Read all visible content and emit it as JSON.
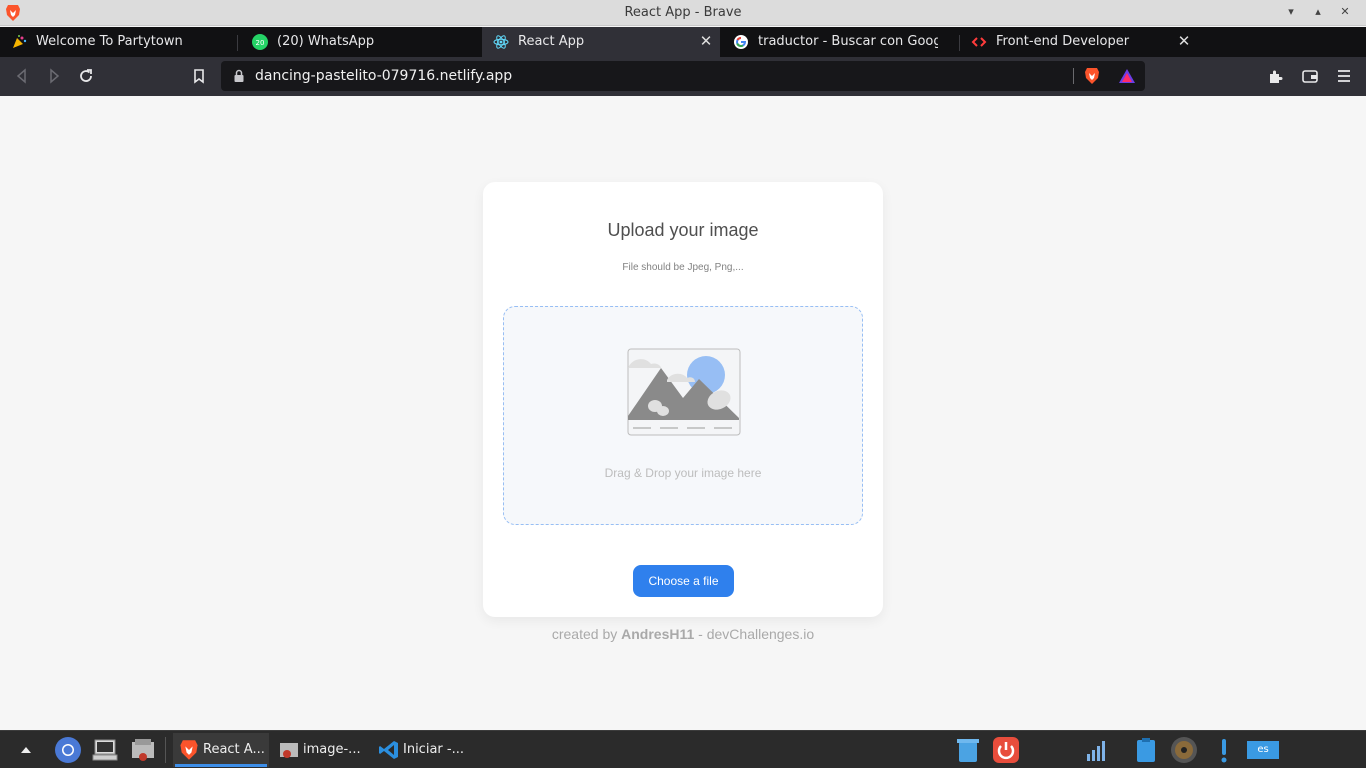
{
  "window": {
    "title": "React App - Brave"
  },
  "tabs": [
    {
      "label": "Welcome To Partytown",
      "icon": "partytown-icon"
    },
    {
      "label": "(20) WhatsApp",
      "icon": "whatsapp-icon",
      "badge": "20"
    },
    {
      "label": "React App",
      "icon": "react-icon",
      "active": true
    },
    {
      "label": "traductor - Buscar con Google",
      "icon": "google-icon"
    },
    {
      "label": "Front-end Developer",
      "icon": "code-icon"
    }
  ],
  "toolbar": {
    "url": "dancing-pastelito-079716.netlify.app"
  },
  "card": {
    "title": "Upload your image",
    "subtitle": "File should be Jpeg, Png,...",
    "dropzone_text": "Drag & Drop your image here",
    "button_label": "Choose a file"
  },
  "footer": {
    "prefix": "created by",
    "author": "AndresH11",
    "suffix": "- devChallenges.io"
  },
  "taskbar": {
    "apps": [
      {
        "label": "React A...",
        "active": true
      },
      {
        "label": "image-..."
      },
      {
        "label": "Iniciar -..."
      }
    ],
    "language": "es"
  },
  "colors": {
    "accent": "#2F80ED",
    "tab_bar": "#111113",
    "toolbar": "#303037",
    "page_bg": "#F6F6F6"
  }
}
